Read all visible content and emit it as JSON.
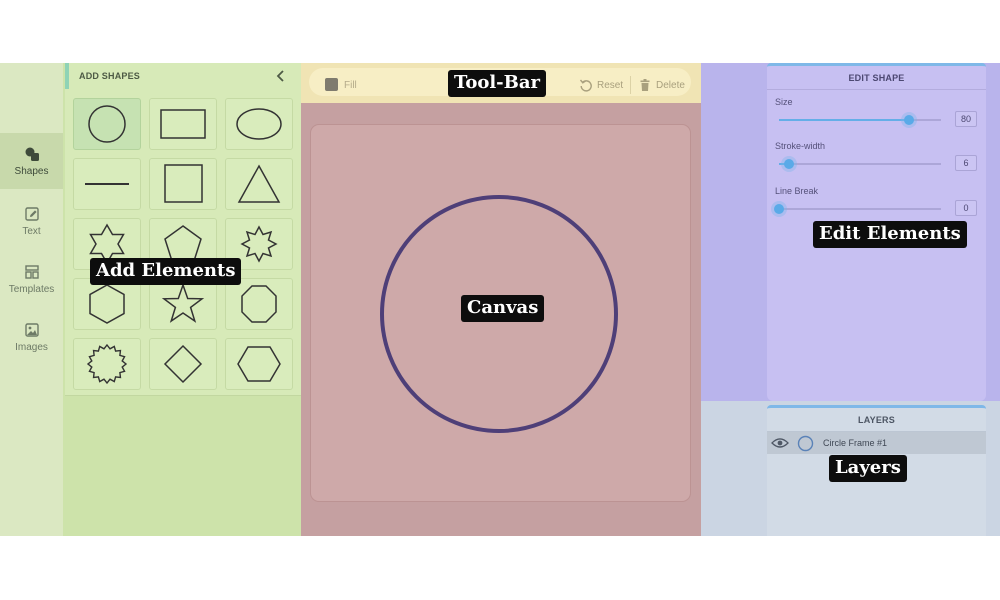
{
  "nav": {
    "items": [
      {
        "label": "Shapes",
        "icon": "shapes-icon",
        "active": true
      },
      {
        "label": "Text",
        "icon": "pencil-icon",
        "active": false
      },
      {
        "label": "Templates",
        "icon": "templates-icon",
        "active": false
      },
      {
        "label": "Images",
        "icon": "image-icon",
        "active": false
      }
    ]
  },
  "shapes_panel": {
    "title": "ADD SHAPES",
    "collapse_icon": "chevron-left-icon",
    "shapes": [
      "circle",
      "rectangle",
      "ellipse",
      "line",
      "square",
      "triangle",
      "star-6",
      "pentagon",
      "star-8",
      "hexagon",
      "star-5",
      "octagon",
      "starburst",
      "diamond",
      "hexagon-wide"
    ]
  },
  "toolbar": {
    "fill_label": "Fill",
    "fill_color": "#7f7b6e",
    "reset_label": "Reset",
    "delete_label": "Delete"
  },
  "canvas": {
    "shape": "circle",
    "stroke_color": "#4e3f78"
  },
  "edit_shape": {
    "title": "EDIT SHAPE",
    "fields": [
      {
        "label": "Size",
        "value": "80",
        "fraction": 0.8
      },
      {
        "label": "Stroke-width",
        "value": "6",
        "fraction": 0.06
      },
      {
        "label": "Line Break",
        "value": "0",
        "fraction": 0.0
      }
    ],
    "accent_color": "#5aaae8"
  },
  "layers": {
    "title": "LAYERS",
    "items": [
      {
        "name": "Circle Frame #1",
        "visible": true
      }
    ]
  },
  "callouts": {
    "toolbar": "Tool-Bar",
    "add_elements": "Add Elements",
    "canvas": "Canvas",
    "edit_elements": "Edit Elements",
    "layers": "Layers"
  }
}
